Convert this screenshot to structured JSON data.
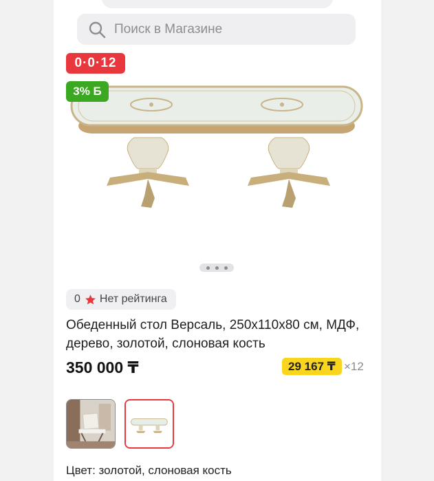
{
  "search": {
    "placeholder": "Поиск в Магазине"
  },
  "badges": {
    "installment": "0·0·12",
    "bonus": "3% Б"
  },
  "rating": {
    "count": "0",
    "label": "Нет рейтинга"
  },
  "product": {
    "title": "Обеденный стол Версаль, 250x110x80 см, МДФ, дерево, золотой, слоновая кость",
    "price": "350 000 ₸",
    "installment_price": "29 167 ₸",
    "installment_multiplier": "×12",
    "color_label": "Цвет: золотой, слоновая кость"
  },
  "gallery": {
    "slides": 3,
    "active_thumbnail": 2
  },
  "colors": {
    "accent_red": "#e8383d",
    "bonus_green": "#3aa821",
    "installment_yellow": "#f9d51d"
  }
}
